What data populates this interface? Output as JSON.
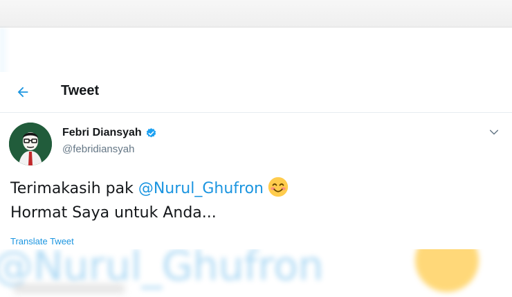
{
  "header": {
    "title": "Tweet"
  },
  "tweet": {
    "display_name": "Febri Diansyah",
    "handle": "@febridiansyah",
    "text_part1": "Terimakasih pak ",
    "mention": "@Nurul_Ghufron",
    "text_line2": "Hormat Saya untuk Anda...",
    "translate_label": "Translate Tweet",
    "emoji": "smiling-face-with-smiling-eyes"
  },
  "background": {
    "blurred_mention": "@Nurul_Ghufron"
  },
  "icons": {
    "back": "arrow-left-icon",
    "verified": "verified-badge-icon",
    "menu": "chevron-down-icon"
  },
  "colors": {
    "accent": "#1b95e0",
    "text": "#14171a",
    "secondary": "#657786",
    "divider": "#e6ecf0"
  }
}
